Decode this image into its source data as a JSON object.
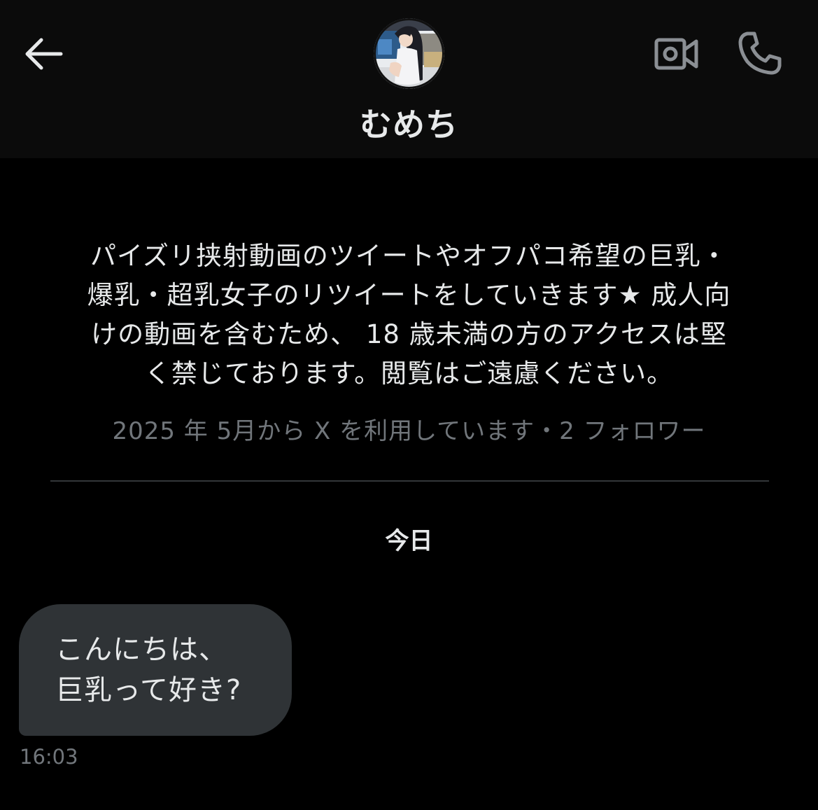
{
  "header": {
    "display_name": "むめち",
    "icons": {
      "back": "arrow-left-icon",
      "video": "video-camera-icon",
      "call": "phone-icon"
    }
  },
  "profile": {
    "bio_lines": [
      "パイズリ挟射動画のツイートやオフパコ希望の巨乳・",
      "爆乳・超乳女子のリツイートをしていきます★ 成人向",
      "けの動画を含むため、 18 歳未満の方のアクセスは堅",
      "く禁じております。閲覧はご遠慮ください。"
    ],
    "meta": "2025 年 5月から X を利用しています・2 フォロワー"
  },
  "conversation": {
    "date_label": "今日",
    "messages": [
      {
        "lines": [
          "こんにちは、",
          "巨乳って好き?"
        ],
        "time": "16:03"
      }
    ]
  },
  "colors": {
    "background": "#000000",
    "header_background": "#0b0b0b",
    "bubble_background": "#2f3336",
    "primary_text": "#e7e9ea",
    "secondary_text": "#71767b",
    "icon_gray": "#8b8f94"
  }
}
